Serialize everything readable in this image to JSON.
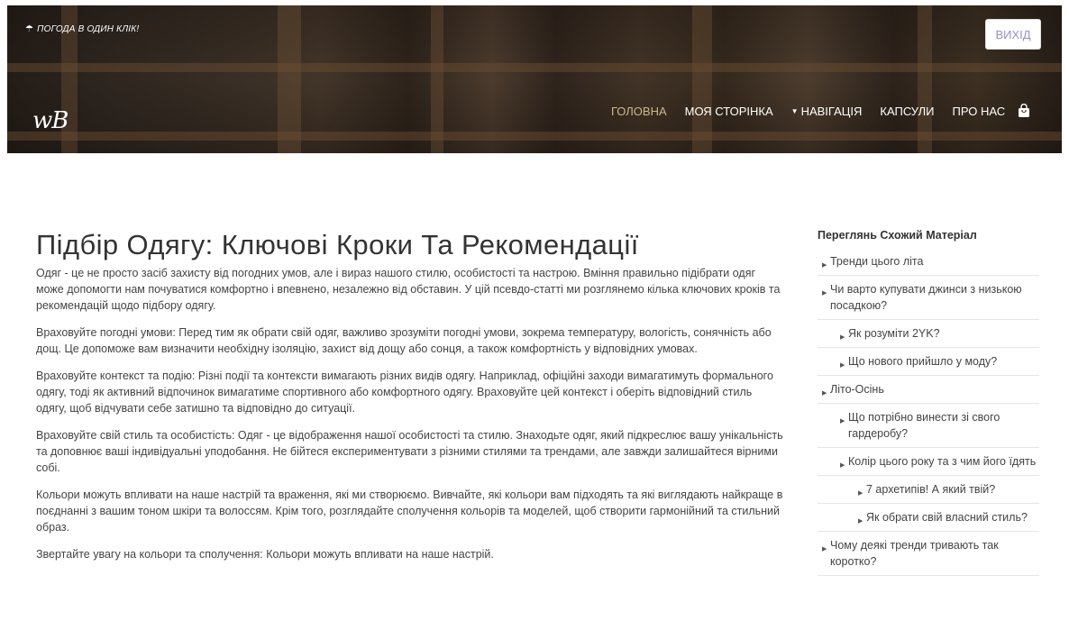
{
  "header": {
    "weather_link": "ПОГОДА В ОДИН КЛІК!",
    "logout_label": "ВИХІД",
    "logo_text": "wB",
    "nav": [
      {
        "label": "ГОЛОВНА",
        "active": true
      },
      {
        "label": "МОЯ СТОРІНКА",
        "active": false
      },
      {
        "label": "НАВІГАЦІЯ",
        "active": false,
        "dropdown": true
      },
      {
        "label": "КАПСУЛИ",
        "active": false
      },
      {
        "label": "ПРО НАС",
        "active": false
      }
    ],
    "cart_icon": "shopping-bag-icon"
  },
  "article": {
    "title": "Підбір Одягу: Ключові Кроки Та Рекомендації",
    "paragraphs": [
      "Одяг - це не просто засіб захисту від погодних умов, але і вираз нашого стилю, особистості та настрою. Вміння правильно підібрати одяг може допомогти нам почуватися комфортно і впевнено, незалежно від обставин. У цій псевдо-статті ми розглянемо кілька ключових кроків та рекомендацій щодо підбору одягу.",
      "Враховуйте погодні умови: Перед тим як обрати свій одяг, важливо зрозуміти погодні умови, зокрема температуру, вологість, сонячність або дощ. Це допоможе вам визначити необхідну ізоляцію, захист від дощу або сонця, а також комфортність у відповідних умовах.",
      "Враховуйте контекст та подію: Різні події та контексти вимагають різних видів одягу. Наприклад, офіційні заходи вимагатимуть формального одягу, тоді як активний відпочинок вимагатиме спортивного або комфортного одягу. Враховуйте цей контекст і оберіть відповідний стиль одягу, щоб відчувати себе затишно та відповідно до ситуації.",
      "Враховуйте свій стиль та особистість: Одяг - це відображення нашої особистості та стилю. Знаходьте одяг, який підкреслює вашу унікальність та доповнює ваші індивідуальні уподобання. Не бійтеся експериментувати з різними стилями та трендами, але завжди залишайтеся вірними собі.",
      "Кольори можуть впливати на наше настрій та враження, які ми створюємо. Вивчайте, які кольори вам підходять та які виглядають найкраще в поєднанні з вашим тоном шкіри та волоссям. Крім того, розглядайте сполучення кольорів та моделей, щоб створити гармонійний та стильний образ.",
      "Звертайте увагу на кольори та сполучення: Кольори можуть впливати на наше настрій."
    ]
  },
  "sidebar": {
    "heading": "Переглянь Схожий Матеріал",
    "items": [
      {
        "label": "Тренди цього літа",
        "level": 1
      },
      {
        "label": "Чи варто купувати джинси з низькою посадкою?",
        "level": 1
      },
      {
        "label": "Як розуміти 2YK?",
        "level": 2
      },
      {
        "label": "Що нового прийшло у моду?",
        "level": 2
      },
      {
        "label": "Літо-Осінь",
        "level": 1
      },
      {
        "label": "Що потрібно винести зі свого гардеробу?",
        "level": 2
      },
      {
        "label": "Колір цього року та з чим його їдять",
        "level": 2
      },
      {
        "label": "7 архетипів! А який твій?",
        "level": 3
      },
      {
        "label": "Як обрати свій власний стиль?",
        "level": 3
      },
      {
        "label": "Чому деякі тренди тривають так коротко?",
        "level": 1
      }
    ]
  },
  "colors": {
    "nav_active": "#c9b98a",
    "logout_text": "#9b8fc8"
  }
}
